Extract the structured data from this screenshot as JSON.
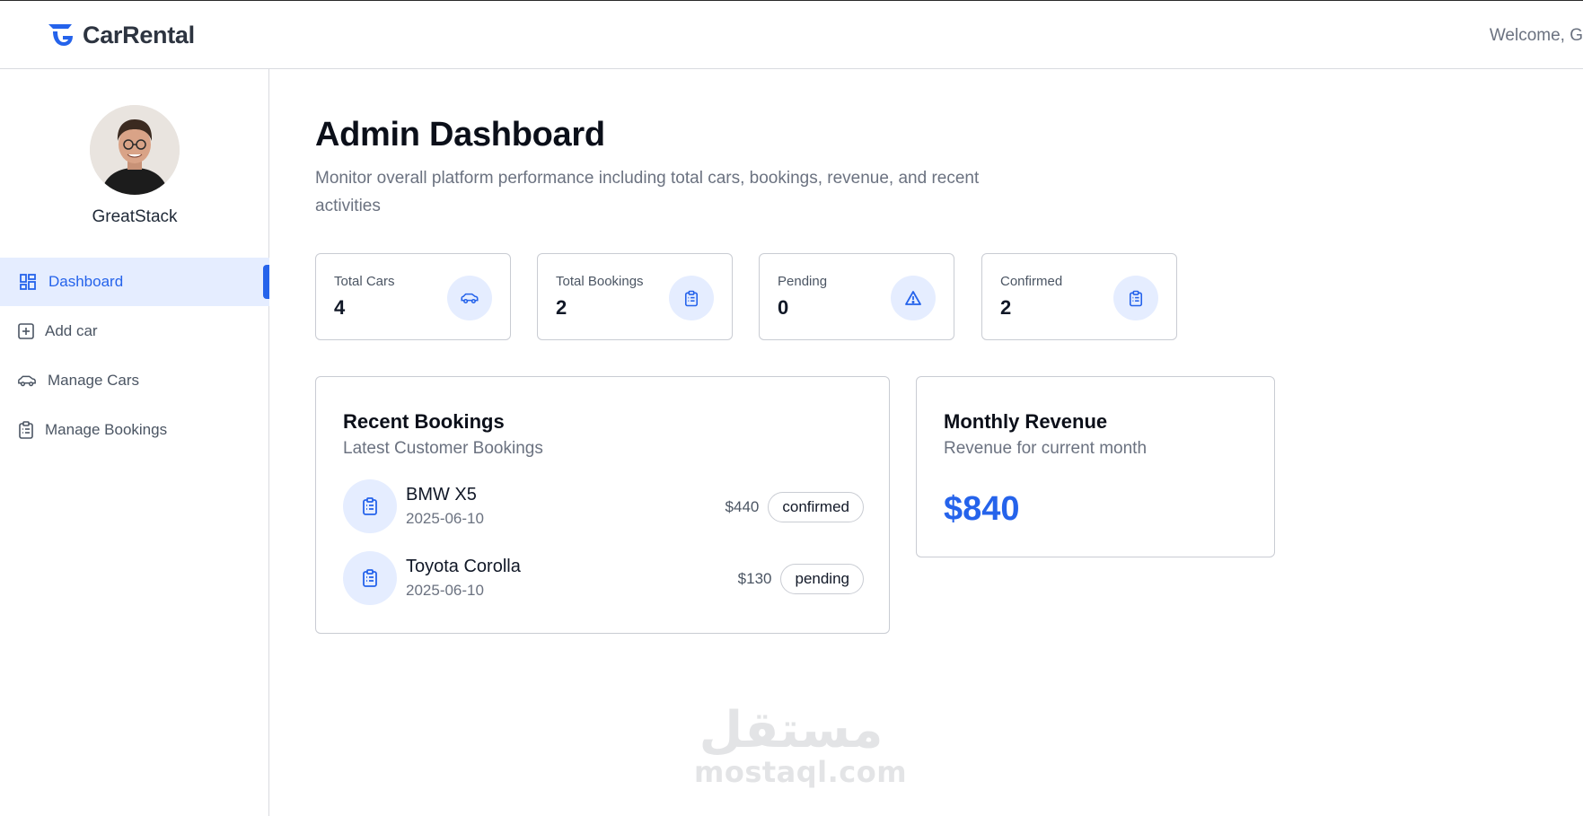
{
  "header": {
    "brand": "CarRental",
    "welcome": "Welcome, G"
  },
  "sidebar": {
    "profile_name": "GreatStack",
    "items": [
      {
        "label": "Dashboard",
        "icon": "dashboard-grid-icon",
        "active": true
      },
      {
        "label": "Add car",
        "icon": "plus-square-icon",
        "active": false
      },
      {
        "label": "Manage Cars",
        "icon": "car-icon",
        "active": false
      },
      {
        "label": "Manage Bookings",
        "icon": "clipboard-list-icon",
        "active": false
      }
    ]
  },
  "main": {
    "title": "Admin Dashboard",
    "subtitle": "Monitor overall platform performance including total cars, bookings, revenue, and recent activities",
    "stats": [
      {
        "label": "Total Cars",
        "value": "4",
        "icon": "car-icon"
      },
      {
        "label": "Total Bookings",
        "value": "2",
        "icon": "clipboard-list-icon"
      },
      {
        "label": "Pending",
        "value": "0",
        "icon": "warning-triangle-icon"
      },
      {
        "label": "Confirmed",
        "value": "2",
        "icon": "clipboard-list-icon"
      }
    ],
    "recent_bookings": {
      "title": "Recent Bookings",
      "subtitle": "Latest Customer Bookings",
      "rows": [
        {
          "car": "BMW X5",
          "date": "2025-06-10",
          "price": "$440",
          "status": "confirmed"
        },
        {
          "car": "Toyota Corolla",
          "date": "2025-06-10",
          "price": "$130",
          "status": "pending"
        }
      ]
    },
    "monthly_revenue": {
      "title": "Monthly Revenue",
      "subtitle": "Revenue for current month",
      "value": "$840"
    }
  },
  "watermark": {
    "arabic": "مستقل",
    "latin": "mostaql.com"
  },
  "colors": {
    "accent": "#2563eb",
    "accent_soft": "#e5edff",
    "border": "#c9ccd3",
    "muted_text": "#6b7280"
  }
}
